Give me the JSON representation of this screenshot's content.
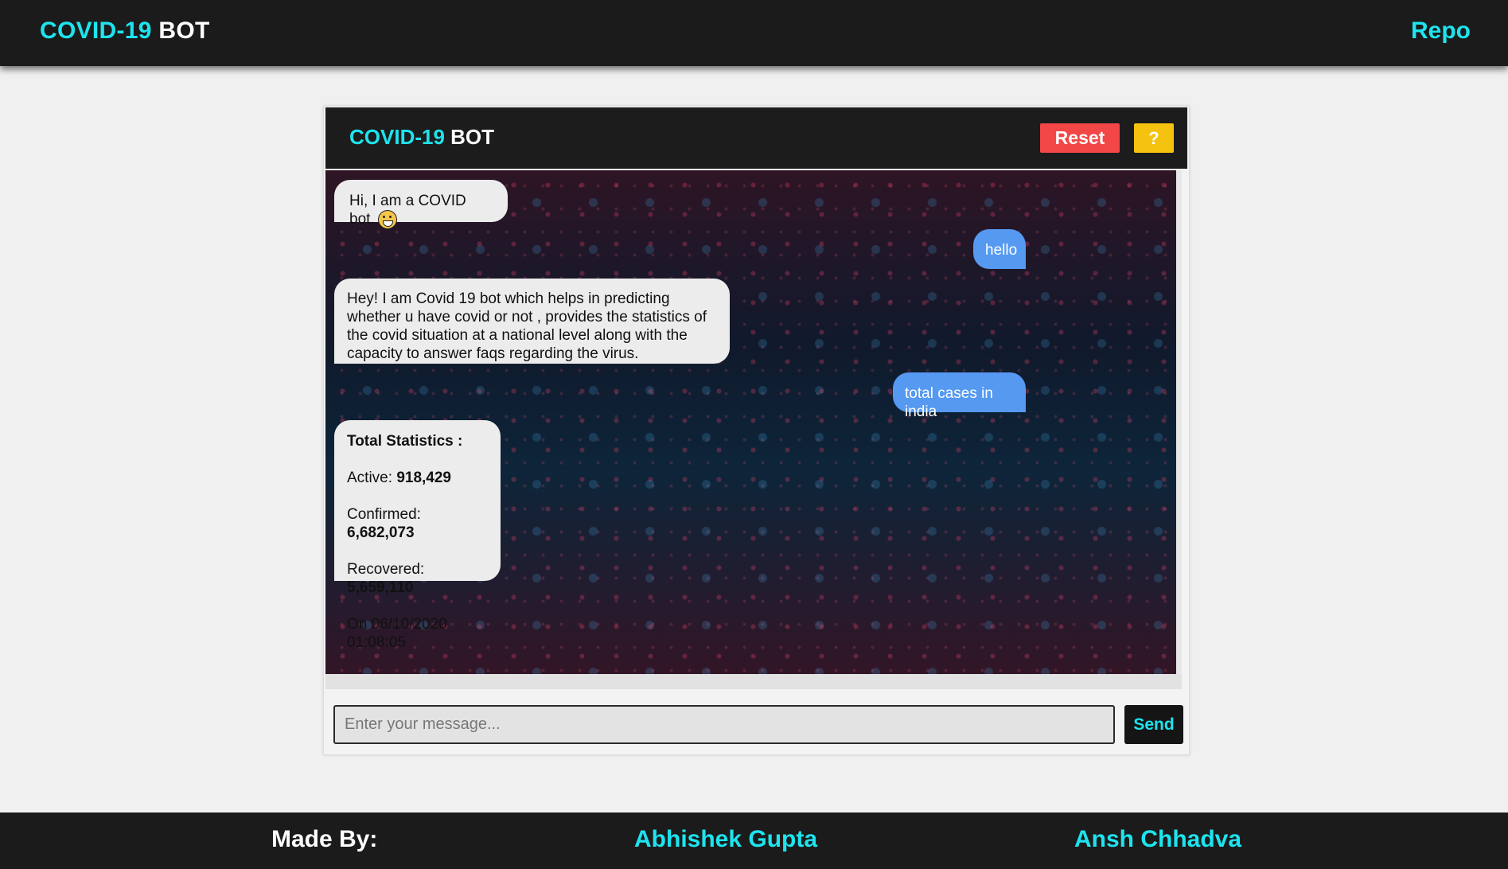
{
  "topbar": {
    "brand_cyan": "COVID-19",
    "brand_white": "BOT",
    "repo_label": "Repo"
  },
  "panel": {
    "title_cyan": "COVID-19",
    "title_white": "BOT",
    "reset_label": "Reset",
    "help_label": "?"
  },
  "messages": [
    {
      "from": "bot",
      "text": "Hi, I am a COVID bot.",
      "emoji": "grinning-face"
    },
    {
      "from": "user",
      "text": "hello"
    },
    {
      "from": "bot",
      "text": "Hey! I am Covid 19 bot which helps in predicting whether u have covid or not , provides the statistics of the covid situation at a national level along with the capacity to answer faqs regarding the virus."
    },
    {
      "from": "user",
      "text": "total cases in india"
    },
    {
      "from": "bot",
      "stats": {
        "heading": "Total Statistics :",
        "active_label": "Active: ",
        "active_value": "918,429",
        "confirmed_label": "Confirmed: ",
        "confirmed_value": "6,682,073",
        "recovered_label": "Recovered: ",
        "recovered_value": "5,659,110",
        "timestamp": "On 06/10/2020 01:08:05"
      }
    }
  ],
  "composer": {
    "placeholder": "Enter your message...",
    "value": "",
    "send_label": "Send"
  },
  "footer": {
    "made_by": "Made By:",
    "author1": "Abhishek Gupta",
    "author2": "Ansh Chhadva"
  },
  "colors": {
    "accent_cyan": "#1de4ee",
    "bar_bg": "#1b1b1b",
    "reset_red": "#f34646",
    "help_yellow": "#f5c20f",
    "user_bubble": "#5599f0",
    "bot_bubble": "#ececec"
  }
}
